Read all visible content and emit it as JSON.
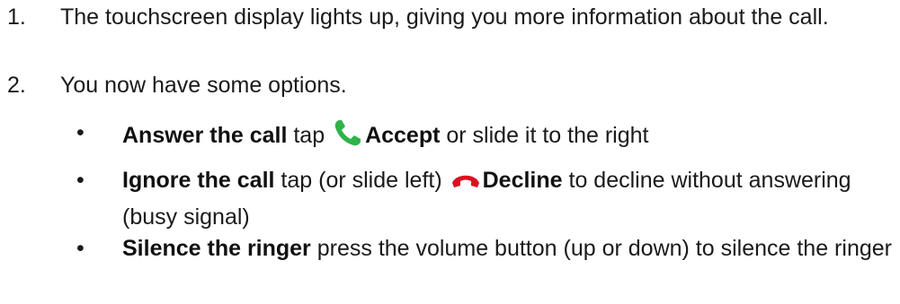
{
  "steps": [
    {
      "number": "1.",
      "text": "The touchscreen display lights up, giving you more information about the call."
    },
    {
      "number": "2.",
      "text": "You now have some options."
    }
  ],
  "bullets": [
    {
      "marker": "•",
      "bold": "Answer the call",
      "pre": " tap ",
      "icon": "phone-accept-icon",
      "action": "Accept",
      "post": " or slide it to the right"
    },
    {
      "marker": "•",
      "bold": "Ignore the call",
      "pre": " tap (or slide left) ",
      "icon": "phone-decline-icon",
      "action": "Decline",
      "post": " to decline without answering (busy signal)"
    },
    {
      "marker": "•",
      "bold": "Silence the ringer",
      "post": " press the volume button (up or down) to silence the ringer"
    }
  ],
  "colors": {
    "accept": "#2fb34a",
    "decline": "#d9121f",
    "text": "#1a1a1a"
  }
}
